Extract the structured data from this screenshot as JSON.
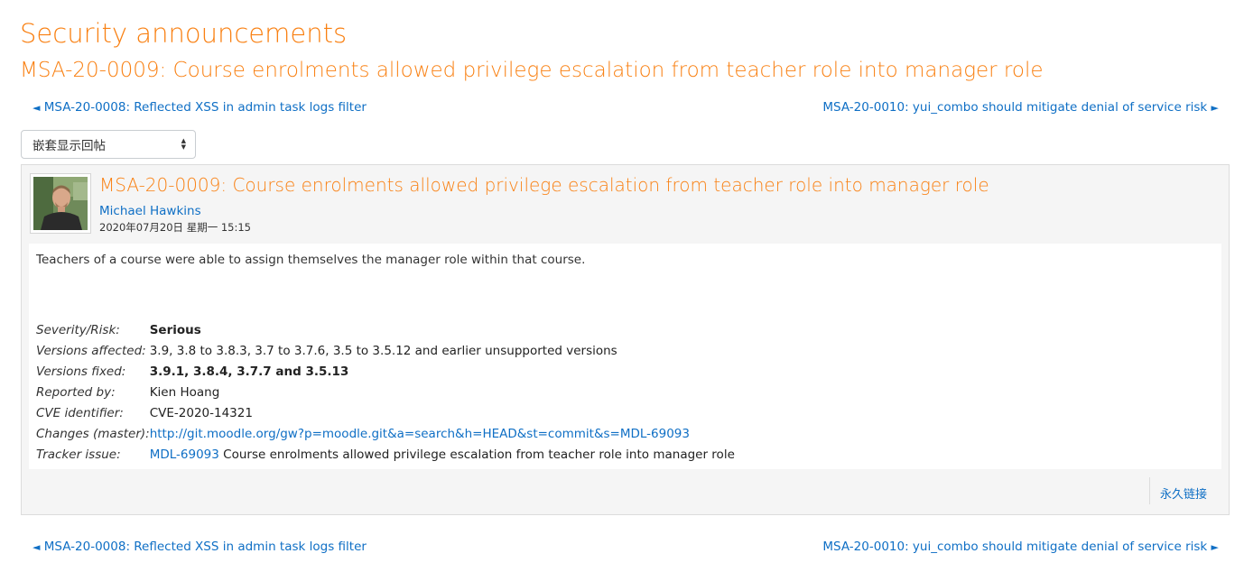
{
  "forum": {
    "title": "Security announcements"
  },
  "discussion": {
    "title": "MSA-20-0009: Course enrolments allowed privilege escalation from teacher role into manager role"
  },
  "nav": {
    "prev_label": "MSA-20-0008: Reflected XSS in admin task logs filter",
    "next_label": "MSA-20-0010: yui_combo should mitigate denial of service risk",
    "prev_arrow": "◄",
    "next_arrow": "►"
  },
  "display_mode": {
    "selected": "嵌套显示回帖"
  },
  "post": {
    "subject": "MSA-20-0009: Course enrolments allowed privilege escalation from teacher role into manager role",
    "author": "Michael Hawkins",
    "date": "2020年07月20日 星期一 15:15",
    "intro": "Teachers of a course were able to assign themselves the manager role within that course.",
    "details": {
      "severity": {
        "label": "Severity/Risk:",
        "value": "Serious"
      },
      "affected": {
        "label": "Versions affected:",
        "value": "3.9, 3.8 to 3.8.3, 3.7 to 3.7.6, 3.5 to 3.5.12 and earlier unsupported versions"
      },
      "fixed": {
        "label": "Versions fixed:",
        "value": "3.9.1, 3.8.4, 3.7.7 and 3.5.13"
      },
      "reporter": {
        "label": "Reported by:",
        "value": "Kien Hoang"
      },
      "cve": {
        "label": "CVE identifier:",
        "value": "CVE-2020-14321"
      },
      "changes": {
        "label": "Changes (master):",
        "value": "http://git.moodle.org/gw?p=moodle.git&a=search&h=HEAD&st=commit&s=MDL-69093"
      },
      "tracker": {
        "label": "Tracker issue:",
        "link": "MDL-69093",
        "text": "Course enrolments allowed privilege escalation from teacher role into manager role"
      }
    },
    "permalink": "永久链接"
  },
  "colors": {
    "accent": "#f98012",
    "link": "#0f6fc5",
    "panel_bg": "#f5f5f5",
    "border": "#dcdcdc"
  }
}
